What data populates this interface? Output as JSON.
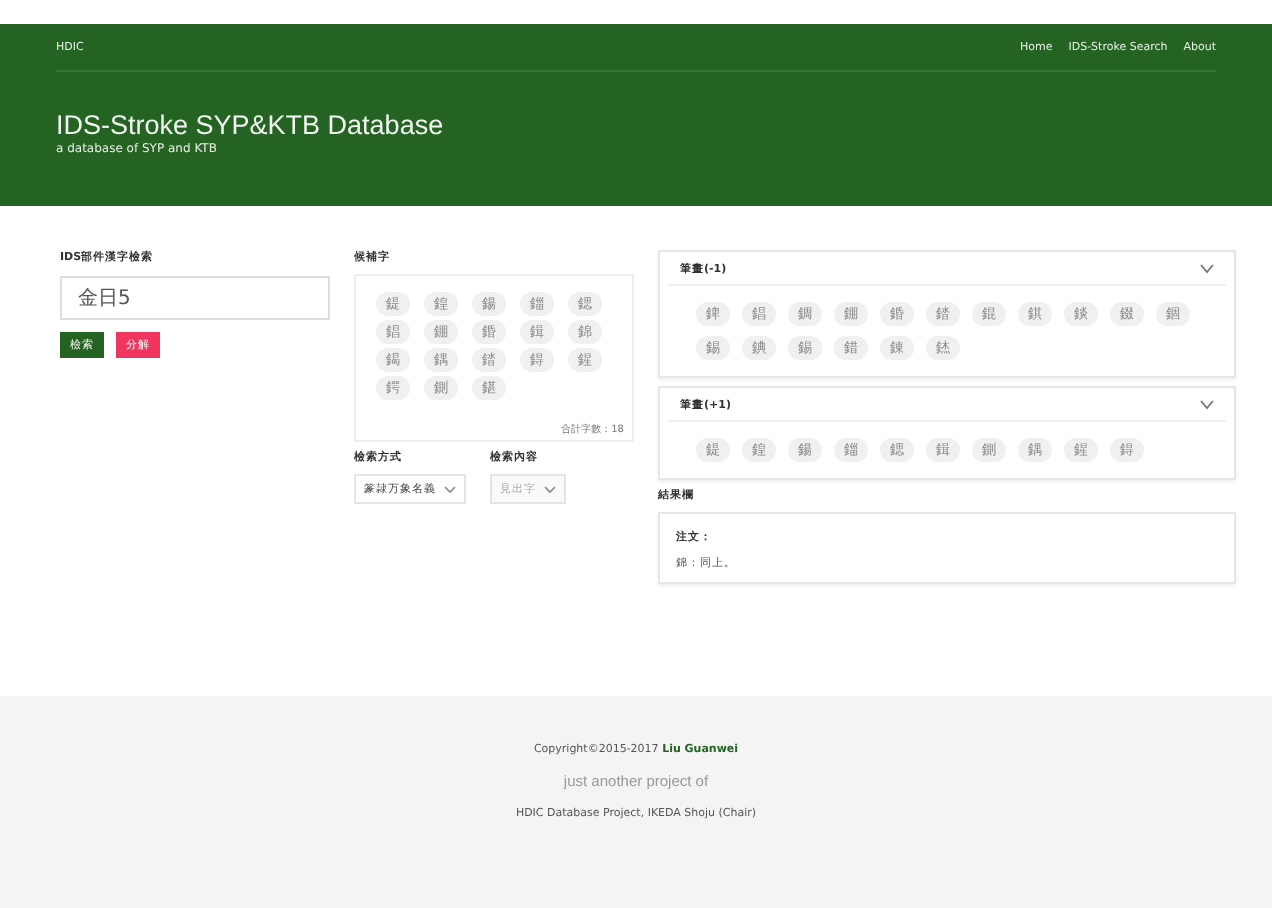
{
  "navbar": {
    "brand": "HDIC",
    "links": [
      {
        "label": "Home"
      },
      {
        "label": "IDS-Stroke Search"
      },
      {
        "label": "About"
      }
    ]
  },
  "header": {
    "title": "IDS-Stroke SYP&KTB Database",
    "subtitle": "a database of SYP and KTB"
  },
  "search": {
    "label": "IDS部件漢字檢索",
    "value": "金日5",
    "buttons": [
      {
        "label": "檢索",
        "kind": "primary"
      },
      {
        "label": "分解",
        "kind": "danger"
      }
    ]
  },
  "candidates": {
    "label": "候補字",
    "chars": [
      "鍉",
      "鍠",
      "鍚",
      "鍿",
      "鍶",
      "錩",
      "錋",
      "錉",
      "鍓",
      "錦",
      "鍻",
      "鍝",
      "錔",
      "鍀",
      "鍟",
      "鍔",
      "鍘",
      "鍖"
    ],
    "total": "合計字數：18"
  },
  "options": [
    {
      "label": "檢索方式",
      "value": "篆隷万象名義",
      "disabled": false
    },
    {
      "label": "檢索內容",
      "value": "見出字",
      "disabled": true
    }
  ],
  "panels": [
    {
      "title": "筆畫(-1)",
      "expanded": true,
      "chars": [
        "錍",
        "錩",
        "錭",
        "錋",
        "錉",
        "錔",
        "錕",
        "錤",
        "錟",
        "錣",
        "錮",
        "錫",
        "錪",
        "錫",
        "錯",
        "錬",
        "錰"
      ]
    },
    {
      "title": "筆畫(+1)",
      "expanded": true,
      "chars": [
        "鍉",
        "鍠",
        "鍚",
        "鍿",
        "鍶",
        "鍓",
        "鍘",
        "鍝",
        "鍟",
        "鍀"
      ]
    }
  ],
  "result": {
    "label": "結果欄",
    "heading": "注文：",
    "text": "錦：同上。"
  },
  "footer": {
    "copyright": "Copyright©2015-2017 **Liu Guanwei**",
    "tagline": "just another project of",
    "project": "HDIC Database Project, IKEDA Shoju (Chair)"
  }
}
